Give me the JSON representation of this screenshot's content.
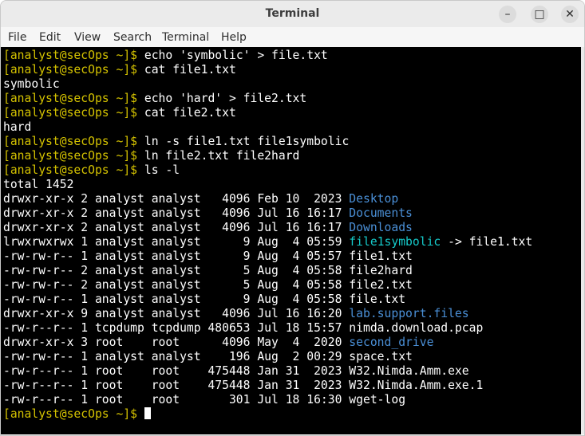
{
  "window": {
    "title": "Terminal",
    "controls": {
      "minimize": "–",
      "maximize": "□",
      "close": "✕"
    }
  },
  "menu": [
    "File",
    "Edit",
    "View",
    "Search",
    "Terminal",
    "Help"
  ],
  "terminal": {
    "prompt": "[analyst@secOps ~]$",
    "lines": [
      {
        "type": "cmd",
        "text": "echo 'symbolic' > file.txt"
      },
      {
        "type": "cmd",
        "text": "cat file1.txt"
      },
      {
        "type": "out",
        "text": "symbolic"
      },
      {
        "type": "cmd",
        "text": "echo 'hard' > file2.txt"
      },
      {
        "type": "cmd",
        "text": "cat file2.txt"
      },
      {
        "type": "out",
        "text": "hard"
      },
      {
        "type": "cmd",
        "text": "ln -s file1.txt file1symbolic"
      },
      {
        "type": "cmd",
        "text": "ln file2.txt file2hard"
      },
      {
        "type": "cmd",
        "text": "ls -l"
      },
      {
        "type": "out",
        "text": "total 1452"
      },
      {
        "type": "ls",
        "meta": "drwxr-xr-x 2 analyst analyst   4096 Feb 10  2023 ",
        "name": "Desktop",
        "kind": "dir"
      },
      {
        "type": "ls",
        "meta": "drwxr-xr-x 2 analyst analyst   4096 Jul 16 16:17 ",
        "name": "Documents",
        "kind": "dir"
      },
      {
        "type": "ls",
        "meta": "drwxr-xr-x 2 analyst analyst   4096 Jul 16 16:17 ",
        "name": "Downloads",
        "kind": "dir"
      },
      {
        "type": "ls",
        "meta": "lrwxrwxrwx 1 analyst analyst      9 Aug  4 05:59 ",
        "name": "file1symbolic",
        "kind": "link",
        "target": " -> file1.txt"
      },
      {
        "type": "ls",
        "meta": "-rw-rw-r-- 1 analyst analyst      9 Aug  4 05:57 ",
        "name": "file1.txt",
        "kind": "file"
      },
      {
        "type": "ls",
        "meta": "-rw-rw-r-- 2 analyst analyst      5 Aug  4 05:58 ",
        "name": "file2hard",
        "kind": "file"
      },
      {
        "type": "ls",
        "meta": "-rw-rw-r-- 2 analyst analyst      5 Aug  4 05:58 ",
        "name": "file2.txt",
        "kind": "file"
      },
      {
        "type": "ls",
        "meta": "-rw-rw-r-- 1 analyst analyst      9 Aug  4 05:58 ",
        "name": "file.txt",
        "kind": "file"
      },
      {
        "type": "ls",
        "meta": "drwxr-xr-x 9 analyst analyst   4096 Jul 16 16:20 ",
        "name": "lab.support.files",
        "kind": "dir"
      },
      {
        "type": "ls",
        "meta": "-rw-r--r-- 1 tcpdump tcpdump 480653 Jul 18 15:57 ",
        "name": "nimda.download.pcap",
        "kind": "file"
      },
      {
        "type": "ls",
        "meta": "drwxr-xr-x 3 root    root      4096 May  4  2020 ",
        "name": "second_drive",
        "kind": "dir"
      },
      {
        "type": "ls",
        "meta": "-rw-rw-r-- 1 analyst analyst    196 Aug  2 00:29 ",
        "name": "space.txt",
        "kind": "file"
      },
      {
        "type": "ls",
        "meta": "-rw-r--r-- 1 root    root    475448 Jan 31  2023 ",
        "name": "W32.Nimda.Amm.exe",
        "kind": "file"
      },
      {
        "type": "ls",
        "meta": "-rw-r--r-- 1 root    root    475448 Jan 31  2023 ",
        "name": "W32.Nimda.Amm.exe.1",
        "kind": "file"
      },
      {
        "type": "ls",
        "meta": "-rw-r--r-- 1 root    root       301 Jul 18 16:30 ",
        "name": "wget-log",
        "kind": "file"
      },
      {
        "type": "input",
        "text": ""
      }
    ]
  },
  "colors": {
    "prompt": "#d4c200",
    "directory": "#4a8fd6",
    "symlink": "#15c9c9",
    "background": "#000000",
    "foreground": "#ffffff"
  }
}
